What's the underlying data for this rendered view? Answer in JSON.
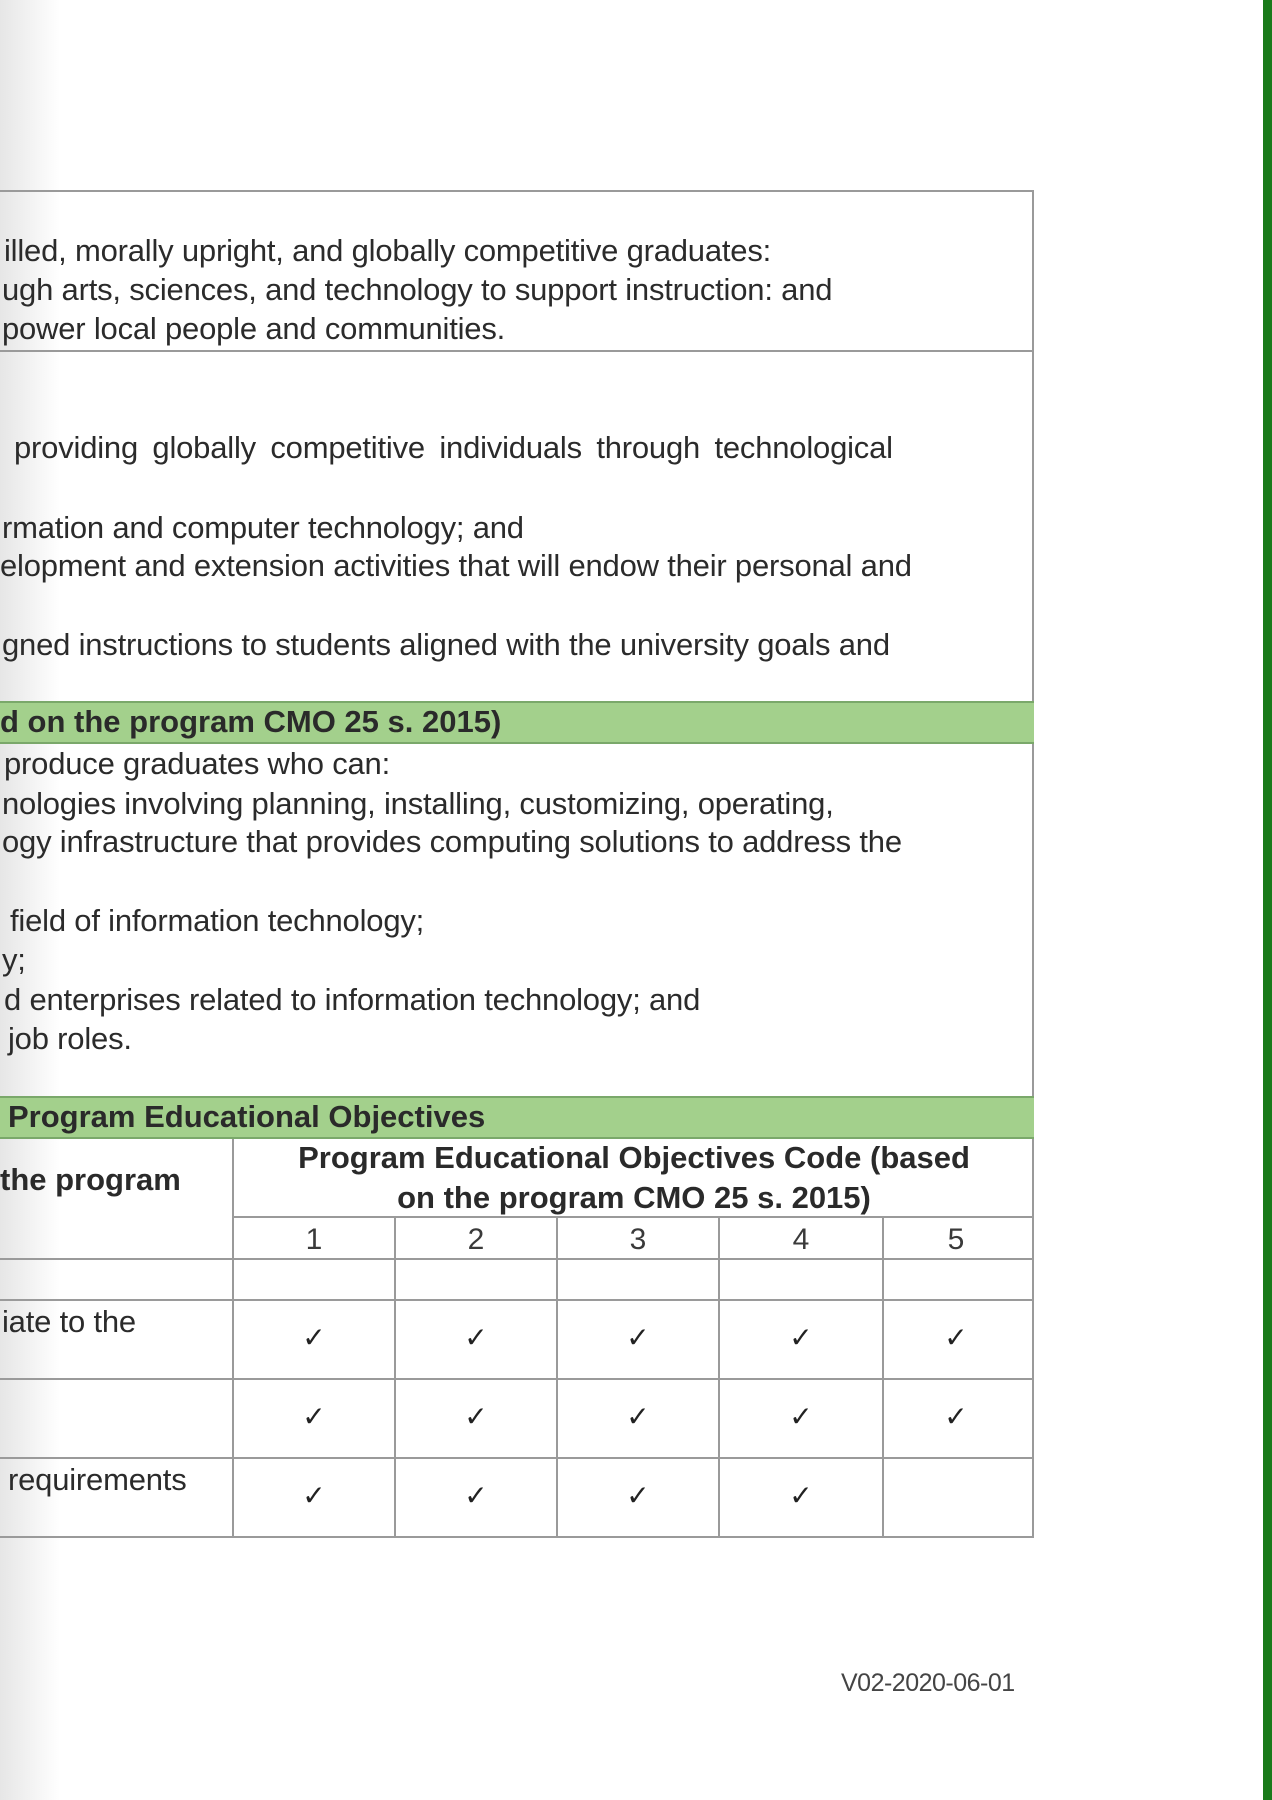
{
  "document": {
    "mission_lines": [
      "illed, morally upright, and globally competitive graduates:",
      "ugh arts, sciences, and technology to support instruction: and",
      "power local people and communities."
    ],
    "goal_lines": [
      "providing  globally  competitive  individuals  through  technological",
      "rmation and computer technology; and",
      "elopment and extension activities that will endow their personal and",
      "gned instructions to students aligned with the university goals and"
    ],
    "peo_section_title": "d on the program CMO 25 s. 2015)",
    "peo_lines": [
      "produce graduates who can:",
      "nologies involving planning, installing, customizing, operating,",
      "ogy infrastructure that provides computing solutions to address the",
      "field of information technology;",
      "y;",
      "d enterprises related to information technology; and",
      "job roles."
    ],
    "table_section_title": "Program Educational Objectives",
    "table": {
      "left_header": "the program",
      "right_header_line1": "Program Educational Objectives Code (based",
      "right_header_line2": "on the program CMO 25 s. 2015)",
      "columns": [
        "1",
        "2",
        "3",
        "4",
        "5"
      ],
      "rows": [
        {
          "label": "",
          "marks": [
            "",
            "",
            "",
            "",
            ""
          ]
        },
        {
          "label": "iate to the",
          "marks": [
            "✓",
            "✓",
            "✓",
            "✓",
            "✓"
          ]
        },
        {
          "label": "",
          "marks": [
            "✓",
            "✓",
            "✓",
            "✓",
            "✓"
          ]
        },
        {
          "label": "requirements",
          "marks": [
            "✓",
            "✓",
            "✓",
            "✓",
            ""
          ]
        }
      ]
    },
    "version_code": "V02-2020-06-01"
  },
  "colors": {
    "green_band": "#a3d08c",
    "right_edge_bar": "#1a7a1a",
    "grid_lines": "#9a9a9a"
  }
}
